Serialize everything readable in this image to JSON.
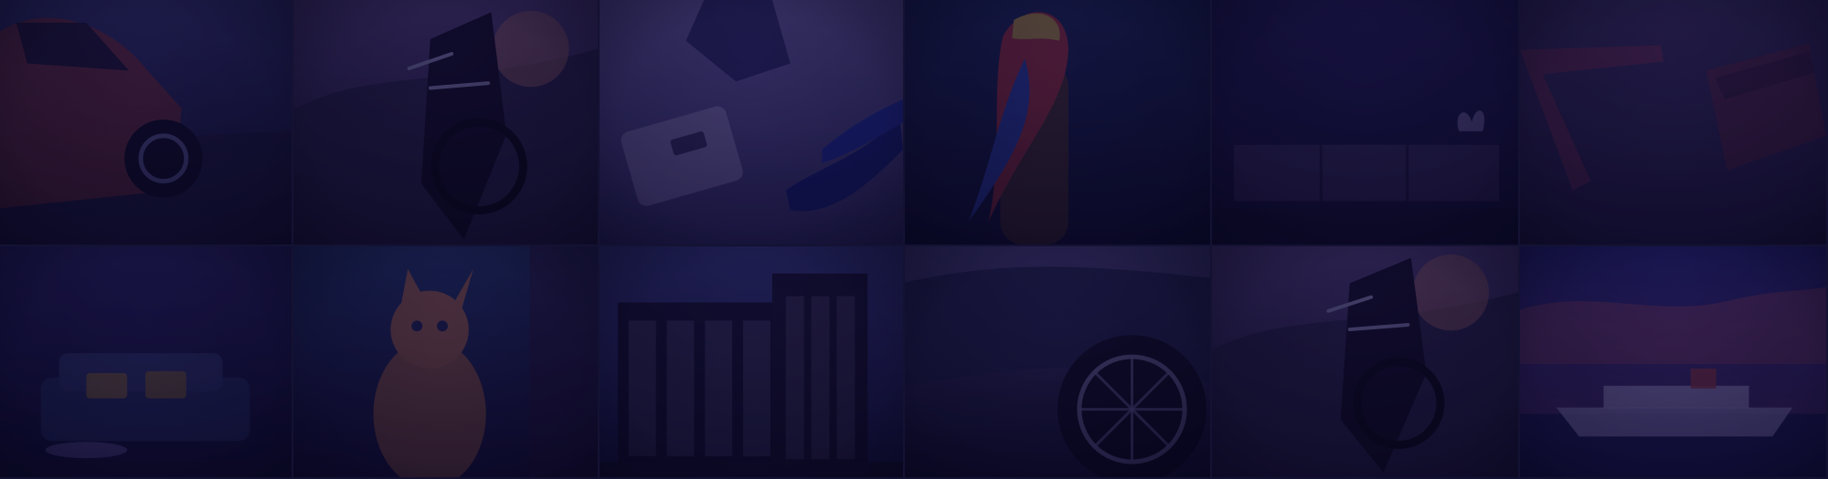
{
  "tiles": [
    {
      "name": "orange-car-photo",
      "scene": "car",
      "palette": {
        "base": "#494b8a",
        "accent": "#8c3e43",
        "dark": "#1b183f"
      }
    },
    {
      "name": "motorcycle-sunset-photo",
      "scene": "motorcycle",
      "palette": {
        "base": "#5a4a81",
        "accent": "#a26b6b",
        "dark": "#18183a"
      }
    },
    {
      "name": "fashion-accessories-photo",
      "scene": "fashion",
      "palette": {
        "base": "#6f6aa0",
        "accent": "#2a3a9c",
        "dark": "#252050"
      }
    },
    {
      "name": "macaw-parrot-photo",
      "scene": "parrot",
      "palette": {
        "base": "#24315f",
        "accent": "#c94045",
        "dark": "#101436"
      }
    },
    {
      "name": "minimal-room-cabinet-photo",
      "scene": "cabinet",
      "palette": {
        "base": "#26255e",
        "accent": "#5d4b7b",
        "dark": "#14143a"
      }
    },
    {
      "name": "leather-wallets-photo",
      "scene": "wallets",
      "palette": {
        "base": "#4b3f65",
        "accent": "#8a3f53",
        "dark": "#2a2348"
      }
    },
    {
      "name": "living-room-sofa-photo",
      "scene": "sofa",
      "palette": {
        "base": "#2d2a62",
        "accent": "#a58a4e",
        "dark": "#171541"
      }
    },
    {
      "name": "orange-cat-photo",
      "scene": "cat",
      "palette": {
        "base": "#26305d",
        "accent": "#b57850",
        "dark": "#171a3e"
      }
    },
    {
      "name": "modern-house-photo",
      "scene": "house",
      "palette": {
        "base": "#303a75",
        "accent": "#1b1733",
        "dark": "#181538"
      }
    },
    {
      "name": "sports-car-wheel-photo",
      "scene": "wheel",
      "palette": {
        "base": "#3b3c6b",
        "accent": "#7f7b9a",
        "dark": "#111129"
      }
    },
    {
      "name": "motorcycle-sunset-photo-second",
      "scene": "motorcycle2",
      "palette": {
        "base": "#554379",
        "accent": "#a16272",
        "dark": "#17143b"
      }
    },
    {
      "name": "cruise-ship-sunset-photo",
      "scene": "ship",
      "palette": {
        "base": "#3a3f8c",
        "accent": "#ba5466",
        "dark": "#25296a"
      }
    }
  ]
}
